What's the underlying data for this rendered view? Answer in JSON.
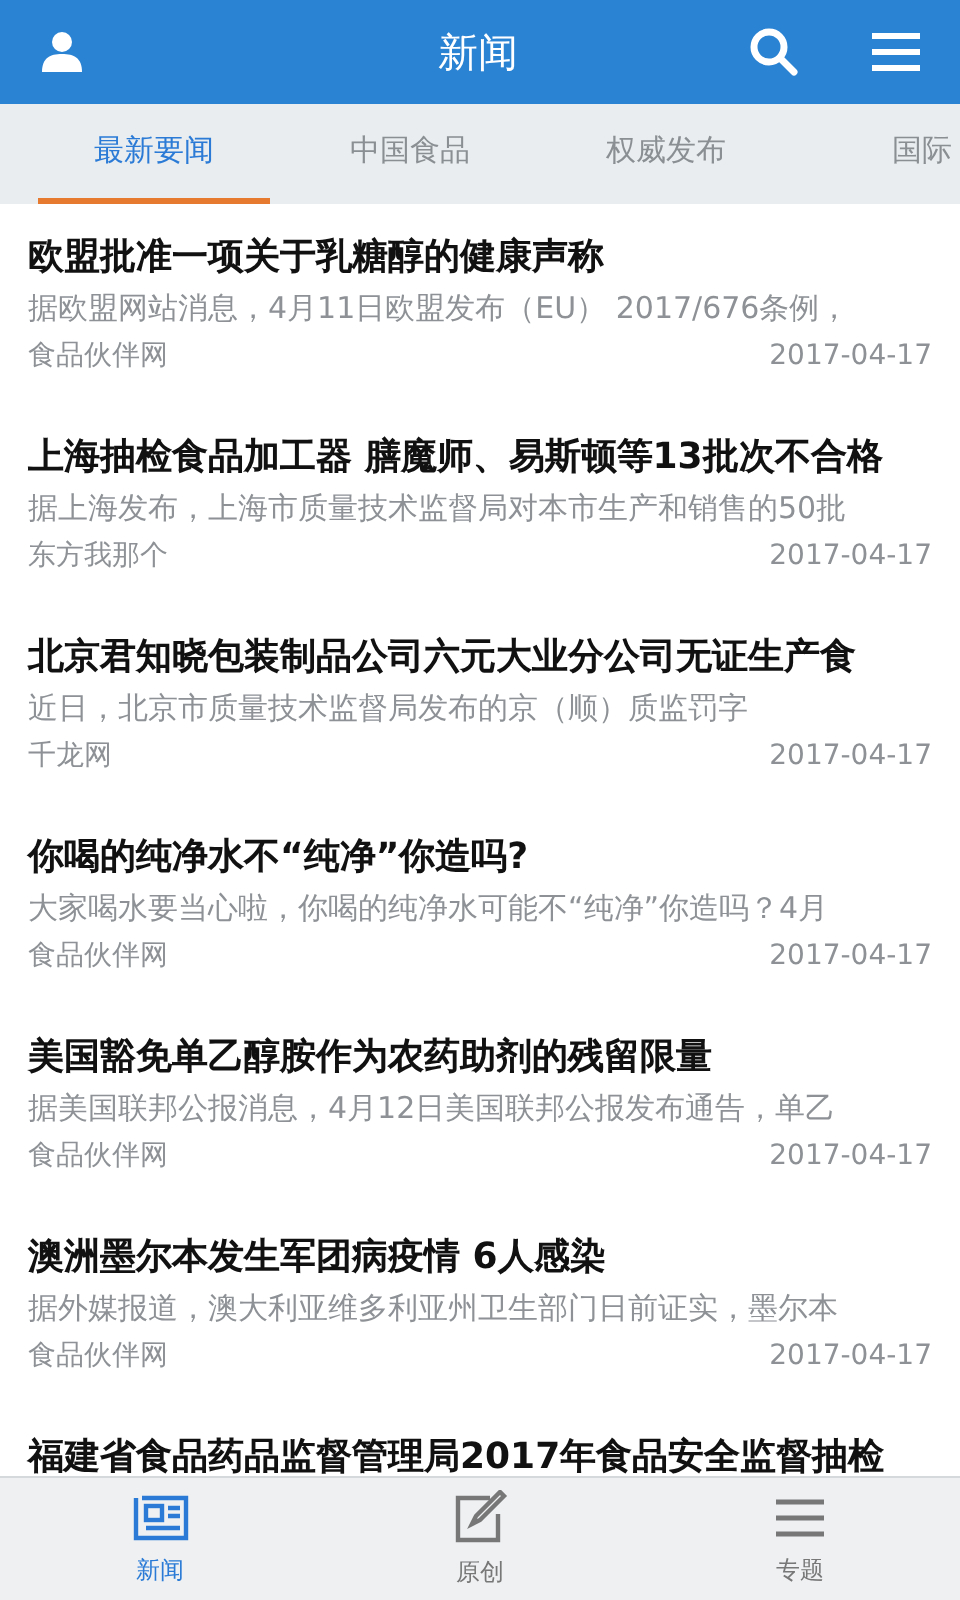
{
  "header": {
    "title": "新闻"
  },
  "tabs": [
    {
      "label": "最新要闻",
      "selected": true
    },
    {
      "label": "中国食品",
      "selected": false
    },
    {
      "label": "权威发布",
      "selected": false
    },
    {
      "label": "国际",
      "selected": false
    }
  ],
  "articles": [
    {
      "title": "欧盟批准一项关于乳糖醇的健康声称",
      "summary": "据欧盟网站消息，4月11日欧盟发布（EU） 2017/676条例，",
      "source": "食品伙伴网",
      "date": "2017-04-17"
    },
    {
      "title": "上海抽检食品加工器 膳魔师、易斯顿等13批次不合格",
      "summary": "据上海发布，上海市质量技术监督局对本市生产和销售的50批",
      "source": "东方我那个",
      "date": "2017-04-17"
    },
    {
      "title": "北京君知晓包装制品公司六元大业分公司无证生产食",
      "summary": "近日，北京市质量技术监督局发布的京（顺）质监罚字",
      "source": "千龙网",
      "date": "2017-04-17"
    },
    {
      "title": "你喝的纯净水不“纯净”你造吗?",
      "summary": "大家喝水要当心啦，你喝的纯净水可能不“纯净”你造吗？4月",
      "source": "食品伙伴网",
      "date": "2017-04-17"
    },
    {
      "title": "美国豁免单乙醇胺作为农药助剂的残留限量",
      "summary": "据美国联邦公报消息，4月12日美国联邦公报发布通告，单乙",
      "source": "食品伙伴网",
      "date": "2017-04-17"
    },
    {
      "title": "澳洲墨尔本发生军团病疫情 6人感染",
      "summary": "据外媒报道，澳大利亚维多利亚州卫生部门日前证实，墨尔本",
      "source": "食品伙伴网",
      "date": "2017-04-17"
    },
    {
      "title": "福建省食品药品监督管理局2017年食品安全监督抽检"
    }
  ],
  "bottom_nav": [
    {
      "label": "新闻",
      "kind": "news",
      "selected": true
    },
    {
      "label": "原创",
      "kind": "edit",
      "selected": false
    },
    {
      "label": "专题",
      "kind": "topics",
      "selected": false
    }
  ]
}
